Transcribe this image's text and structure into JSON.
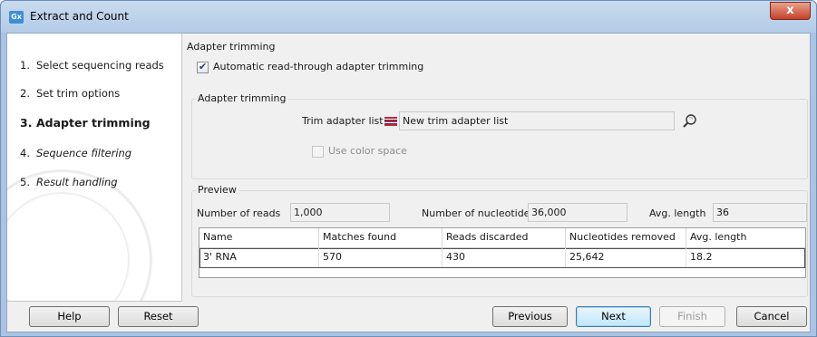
{
  "window": {
    "app_icon_text": "Gx",
    "title": "Extract and Count",
    "close_glyph": "x"
  },
  "steps": [
    {
      "num": "1.",
      "label": "Select sequencing reads",
      "state": "done"
    },
    {
      "num": "2.",
      "label": "Set trim options",
      "state": "done"
    },
    {
      "num": "3.",
      "label": "Adapter trimming",
      "state": "active"
    },
    {
      "num": "4.",
      "label": "Sequence filtering",
      "state": "future"
    },
    {
      "num": "5.",
      "label": "Result handling",
      "state": "future"
    }
  ],
  "adapter_section": {
    "title": "Adapter trimming",
    "auto_checkbox_label": "Automatic read-through adapter trimming",
    "auto_checked": true,
    "group_title": "Adapter trimming",
    "trim_list_label": "Trim adapter list",
    "trim_list_value": "New trim adapter list",
    "trim_list_icon": "adapter-list-icon",
    "browse_icon": "search-icon",
    "color_space_label": "Use color space",
    "color_space_checked": false
  },
  "preview": {
    "title": "Preview",
    "reads_label": "Number of reads",
    "reads_value": "1,000",
    "nucleotides_label": "Number of nucleotides",
    "nucleotides_value": "36,000",
    "avg_label": "Avg. length",
    "avg_value": "36",
    "columns": [
      "Name",
      "Matches found",
      "Reads discarded",
      "Nucleotides removed",
      "Avg. length"
    ],
    "rows": [
      [
        "3' RNA",
        "570",
        "430",
        "25,642",
        "18.2"
      ]
    ]
  },
  "buttons": {
    "help": "Help",
    "reset": "Reset",
    "previous": "Previous",
    "next": "Next",
    "finish": "Finish",
    "cancel": "Cancel"
  }
}
